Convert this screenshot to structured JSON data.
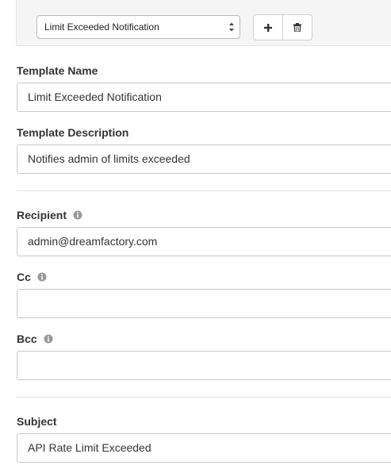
{
  "template_select": {
    "value": "Limit Exceeded Notification"
  },
  "fields": {
    "template_name": {
      "label": "Template Name",
      "value": "Limit Exceeded Notification"
    },
    "template_description": {
      "label": "Template Description",
      "value": "Notifies admin of limits exceeded"
    },
    "recipient": {
      "label": "Recipient",
      "value": "admin@dreamfactory.com"
    },
    "cc": {
      "label": "Cc",
      "value": ""
    },
    "bcc": {
      "label": "Bcc",
      "value": ""
    },
    "subject": {
      "label": "Subject",
      "value": "API Rate Limit Exceeded"
    }
  },
  "icons": {
    "add": "plus-icon",
    "delete": "trash-icon",
    "info": "info-icon"
  }
}
